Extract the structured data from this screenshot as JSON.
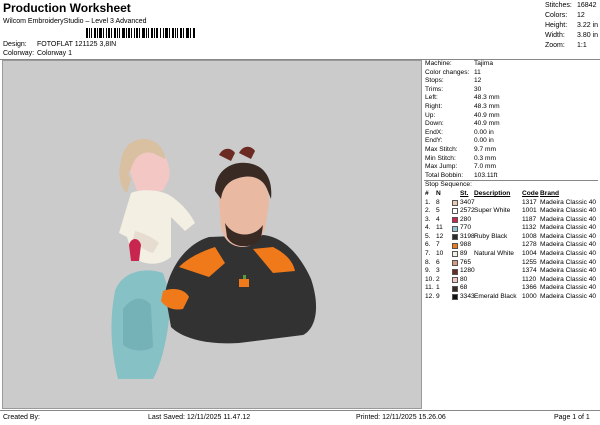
{
  "header": {
    "title": "Production Worksheet",
    "subtitle": "Wilcom EmbroideryStudio – Level 3 Advanced",
    "design_label": "Design:",
    "design_value": "FOTOFLAT 121125 3,8IN",
    "colorway_label": "Colorway:",
    "colorway_value": "Colorway 1"
  },
  "stats": [
    {
      "label": "Stitches:",
      "value": "16842"
    },
    {
      "label": "Colors:",
      "value": "12"
    },
    {
      "label": "Height:",
      "value": "3.22 in"
    },
    {
      "label": "Width:",
      "value": "3.80 in"
    },
    {
      "label": "Zoom:",
      "value": "1:1"
    }
  ],
  "machine_info": [
    {
      "label": "Machine:",
      "value": "Tajima"
    },
    {
      "label": "Color changes:",
      "value": "11"
    },
    {
      "label": "Stops:",
      "value": "12"
    },
    {
      "label": "Trims:",
      "value": "30"
    },
    {
      "label": "Left:",
      "value": "48.3 mm"
    },
    {
      "label": "Right:",
      "value": "48.3 mm"
    },
    {
      "label": "Up:",
      "value": "40.9 mm"
    },
    {
      "label": "Down:",
      "value": "40.9 mm"
    },
    {
      "label": "EndX:",
      "value": "0.00 in"
    },
    {
      "label": "EndY:",
      "value": "0.00 in"
    },
    {
      "label": "Max Stitch:",
      "value": "9.7 mm"
    },
    {
      "label": "Min Stitch:",
      "value": "0.3 mm"
    },
    {
      "label": "Max Jump:",
      "value": "7.0 mm"
    },
    {
      "label": "Total Bobbin:",
      "value": "103.11ft"
    }
  ],
  "stop_sequence": {
    "title": "Stop Sequence:",
    "headers": {
      "num": "#",
      "n": "N",
      "st": "St.",
      "desc": "Description",
      "code": "Code",
      "brand": "Brand"
    },
    "rows": [
      {
        "num": "1.",
        "n": "8",
        "st": "3407",
        "desc": "",
        "code": "1317",
        "brand": "Madeira Classic 40",
        "color": "#e9c9b2"
      },
      {
        "num": "2.",
        "n": "5",
        "st": "2572",
        "desc": "Super White",
        "code": "1001",
        "brand": "Madeira Classic 40",
        "color": "#ffffff"
      },
      {
        "num": "3.",
        "n": "4",
        "st": "280",
        "desc": "",
        "code": "1187",
        "brand": "Madeira Classic 40",
        "color": "#c8264f"
      },
      {
        "num": "4.",
        "n": "11",
        "st": "770",
        "desc": "",
        "code": "1132",
        "brand": "Madeira Classic 40",
        "color": "#8fc4d6"
      },
      {
        "num": "5.",
        "n": "12",
        "st": "3198",
        "desc": "Ruby Black",
        "code": "1008",
        "brand": "Madeira Classic 40",
        "color": "#2b2b2b"
      },
      {
        "num": "6.",
        "n": "7",
        "st": "988",
        "desc": "",
        "code": "1278",
        "brand": "Madeira Classic 40",
        "color": "#f07a1a"
      },
      {
        "num": "7.",
        "n": "10",
        "st": "89",
        "desc": "Natural White",
        "code": "1004",
        "brand": "Madeira Classic 40",
        "color": "#f3efe2"
      },
      {
        "num": "8.",
        "n": "6",
        "st": "765",
        "desc": "",
        "code": "1255",
        "brand": "Madeira Classic 40",
        "color": "#d99a82"
      },
      {
        "num": "9.",
        "n": "3",
        "st": "1280",
        "desc": "",
        "code": "1374",
        "brand": "Madeira Classic 40",
        "color": "#6b2b22"
      },
      {
        "num": "10.",
        "n": "2",
        "st": "80",
        "desc": "",
        "code": "1120",
        "brand": "Madeira Classic 40",
        "color": "#f2c7c4"
      },
      {
        "num": "11.",
        "n": "1",
        "st": "68",
        "desc": "",
        "code": "1366",
        "brand": "Madeira Classic 40",
        "color": "#3a2a24"
      },
      {
        "num": "12.",
        "n": "9",
        "st": "3343",
        "desc": "Emerald Black",
        "code": "1000",
        "brand": "Madeira Classic 40",
        "color": "#111111"
      }
    ]
  },
  "footer": {
    "created_by": "Created By:",
    "last_saved": "Last Saved: 12/11/2025 11.47.12",
    "printed": "Printed: 12/11/2025 15.26.06",
    "page": "Page 1 of 1"
  }
}
